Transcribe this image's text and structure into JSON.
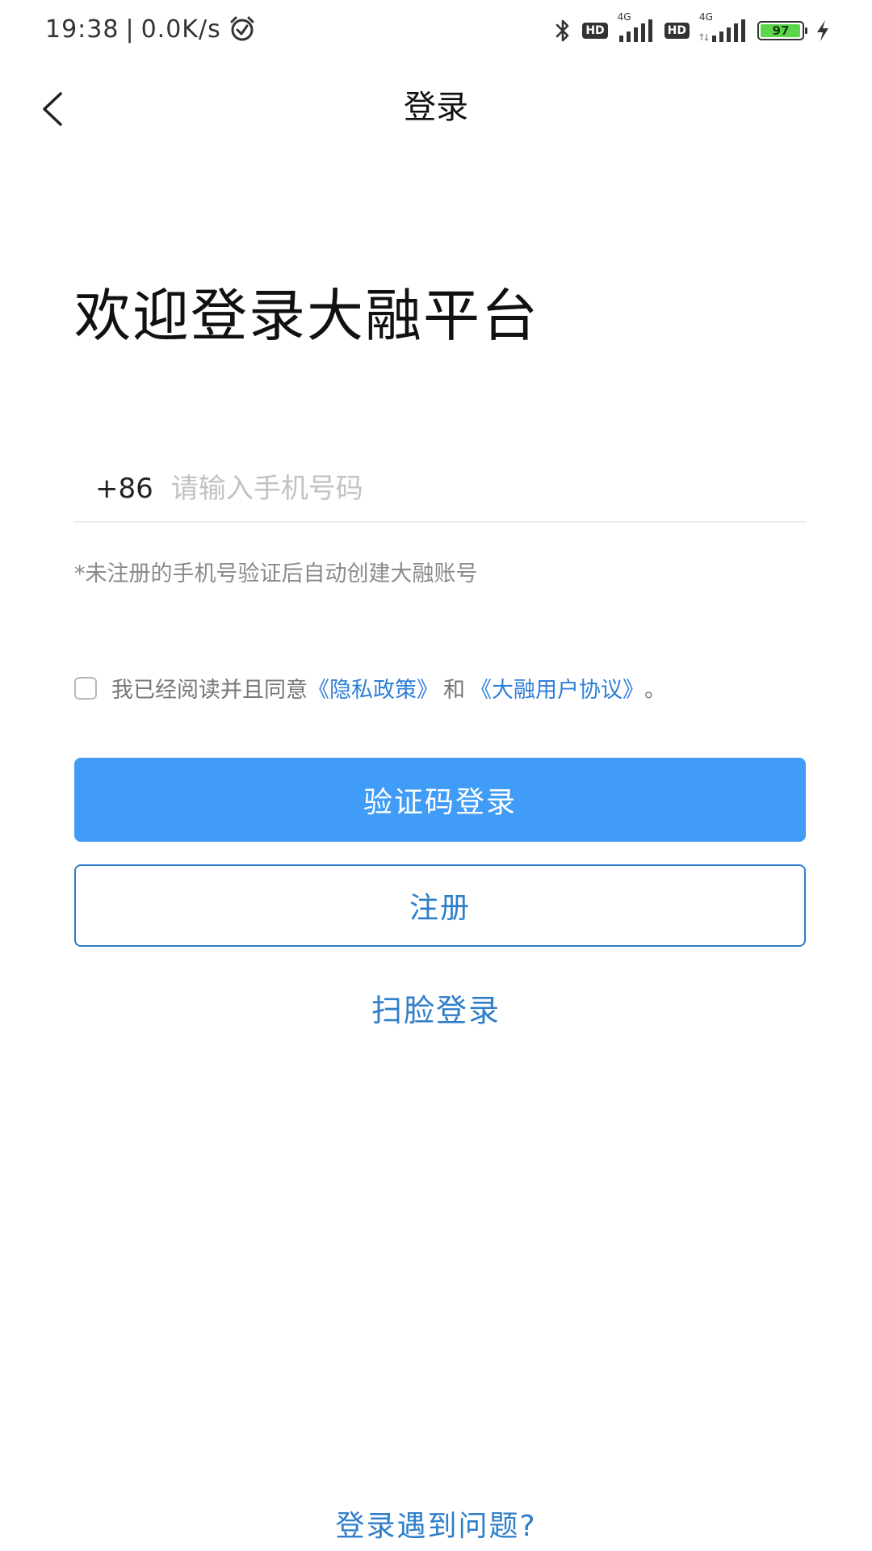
{
  "status_bar": {
    "time": "19:38",
    "separator": "|",
    "net_speed": "0.0K/s",
    "hd1": "HD",
    "net1": "4G",
    "hd2": "HD",
    "net2": "4G",
    "battery": "97",
    "battery_level": 0.97
  },
  "header": {
    "title": "登录"
  },
  "welcome": "欢迎登录大融平台",
  "phone": {
    "country_code": "+86",
    "placeholder": "请输入手机号码",
    "value": ""
  },
  "hint": "*未注册的手机号验证后自动创建大融账号",
  "agreement": {
    "prefix": "我已经阅读并且同意",
    "privacy_link": "《隐私政策》",
    "and": "和",
    "user_link": "《大融用户协议》",
    "suffix": "。",
    "checked": false
  },
  "buttons": {
    "sms_login": "验证码登录",
    "register": "注册",
    "face_login": "扫脸登录",
    "trouble": "登录遇到问题?"
  },
  "colors": {
    "primary": "#409cf6",
    "link": "#2e7ec9"
  }
}
